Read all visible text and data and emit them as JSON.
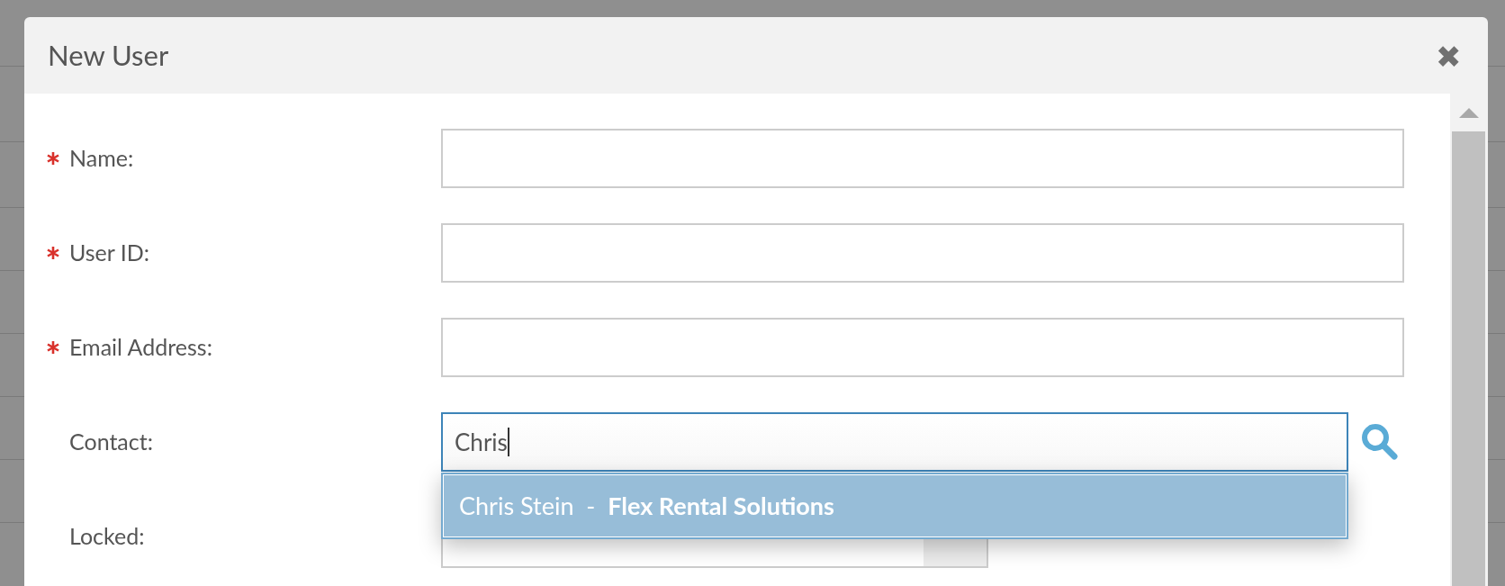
{
  "dialog": {
    "title": "New User",
    "close": "✖"
  },
  "fields": [
    {
      "label": "Name:",
      "required": true,
      "kind": "text"
    },
    {
      "label": "User ID:",
      "required": true,
      "kind": "text"
    },
    {
      "label": "Email Address:",
      "required": true,
      "kind": "text"
    },
    {
      "label": "Contact:",
      "required": false,
      "kind": "lookup",
      "value": "Chris",
      "focused": true
    },
    {
      "label": "Locked:",
      "required": false,
      "kind": "select"
    }
  ],
  "suggestions": [
    {
      "text": "Chris Stein  -  **Flex Rental Solutions**",
      "selected": true
    }
  ]
}
